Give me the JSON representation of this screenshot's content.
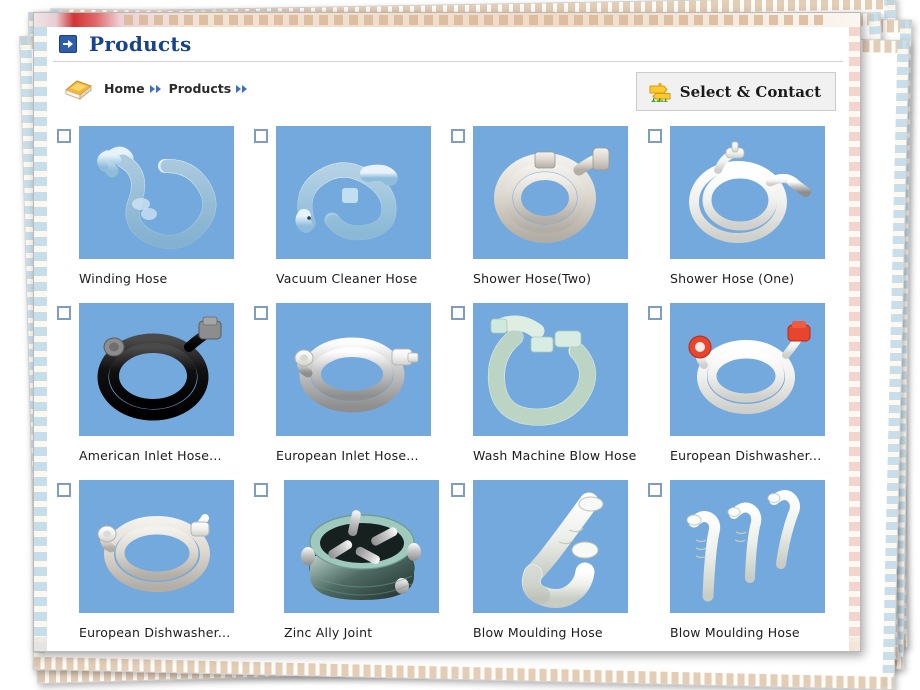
{
  "window": {
    "title": "Products",
    "title_icon": "arrow-right-box-icon"
  },
  "toolbar": {
    "home_icon": "home-folder-icon",
    "breadcrumb": {
      "items": [
        "Home",
        "Products"
      ],
      "separator_icon": "double-chevron-right-icon",
      "trailing_separator": true
    },
    "select_contact": {
      "label": "Select & Contact",
      "icon": "signpost-icon"
    }
  },
  "grid": {
    "columns": 4,
    "image_background_color": "#74a9dd",
    "checkbox_border_color": "#7f9dbe",
    "products": [
      {
        "label": "Winding Hose",
        "art": "winding-hose",
        "checked": false
      },
      {
        "label": "Vacuum Cleaner Hose",
        "art": "vacuum-cleaner-hose",
        "checked": false
      },
      {
        "label": "Shower Hose(Two)",
        "art": "shower-hose-two",
        "checked": false
      },
      {
        "label": "Shower Hose (One)",
        "art": "shower-hose-one",
        "checked": false
      },
      {
        "label": "American Inlet Hose...",
        "art": "american-inlet-hose",
        "checked": false
      },
      {
        "label": "European Inlet Hose...",
        "art": "european-inlet-hose",
        "checked": false
      },
      {
        "label": "Wash Machine Blow Hose",
        "art": "wash-machine-blow-hose",
        "checked": false
      },
      {
        "label": "European Dishwasher...",
        "art": "european-dishwasher-1",
        "checked": false
      },
      {
        "label": "European Dishwasher...",
        "art": "european-dishwasher-2",
        "checked": false
      },
      {
        "label": "Zinc Ally Joint",
        "art": "zinc-ally-joint",
        "checked": false
      },
      {
        "label": "Blow Moulding Hose",
        "art": "blow-moulding-hose-1",
        "checked": false
      },
      {
        "label": "Blow Moulding Hose",
        "art": "blow-moulding-hose-2",
        "checked": false
      }
    ]
  },
  "colors": {
    "title_text": "#16438c",
    "title_icon_bg": "#2f5fa8",
    "breadcrumb_arrow": "#3f6fc4",
    "product_bg": "#74a9dd",
    "page_bg": "#ffffff"
  }
}
